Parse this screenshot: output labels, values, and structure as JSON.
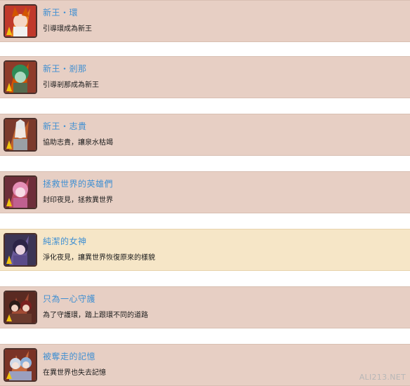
{
  "achievements": [
    {
      "title": "新王・環",
      "description": "引導環成為新王",
      "highlighted": false,
      "icon": "portrait-tamaki-icon"
    },
    {
      "title": "新王・剎那",
      "description": "引導剎那成為新王",
      "highlighted": false,
      "icon": "portrait-setsuna-icon"
    },
    {
      "title": "新王・志貴",
      "description": "協助志貴，讓泉水枯竭",
      "highlighted": false,
      "icon": "portrait-shiki-icon"
    },
    {
      "title": "拯救世界的英雄們",
      "description": "封印夜見，拯救異世界",
      "highlighted": false,
      "icon": "portrait-heroes-icon"
    },
    {
      "title": "純潔的女神",
      "description": "淨化夜見，讓異世界恢復原來的樣貌",
      "highlighted": true,
      "icon": "portrait-goddess-icon"
    },
    {
      "title": "只為一心守護",
      "description": "為了守護環，踏上跟環不同的道路",
      "highlighted": false,
      "icon": "portrait-guardians-icon"
    },
    {
      "title": "被奪走的記憶",
      "description": "在異世界也失去記憶",
      "highlighted": false,
      "icon": "portrait-memory-icon"
    }
  ],
  "watermark": "ALI213.NET",
  "colors": {
    "row_bg": "#e7cfc4",
    "row_highlight_bg": "#f6e6c7",
    "title": "#3f8fd2",
    "description": "#1b1b1b"
  }
}
